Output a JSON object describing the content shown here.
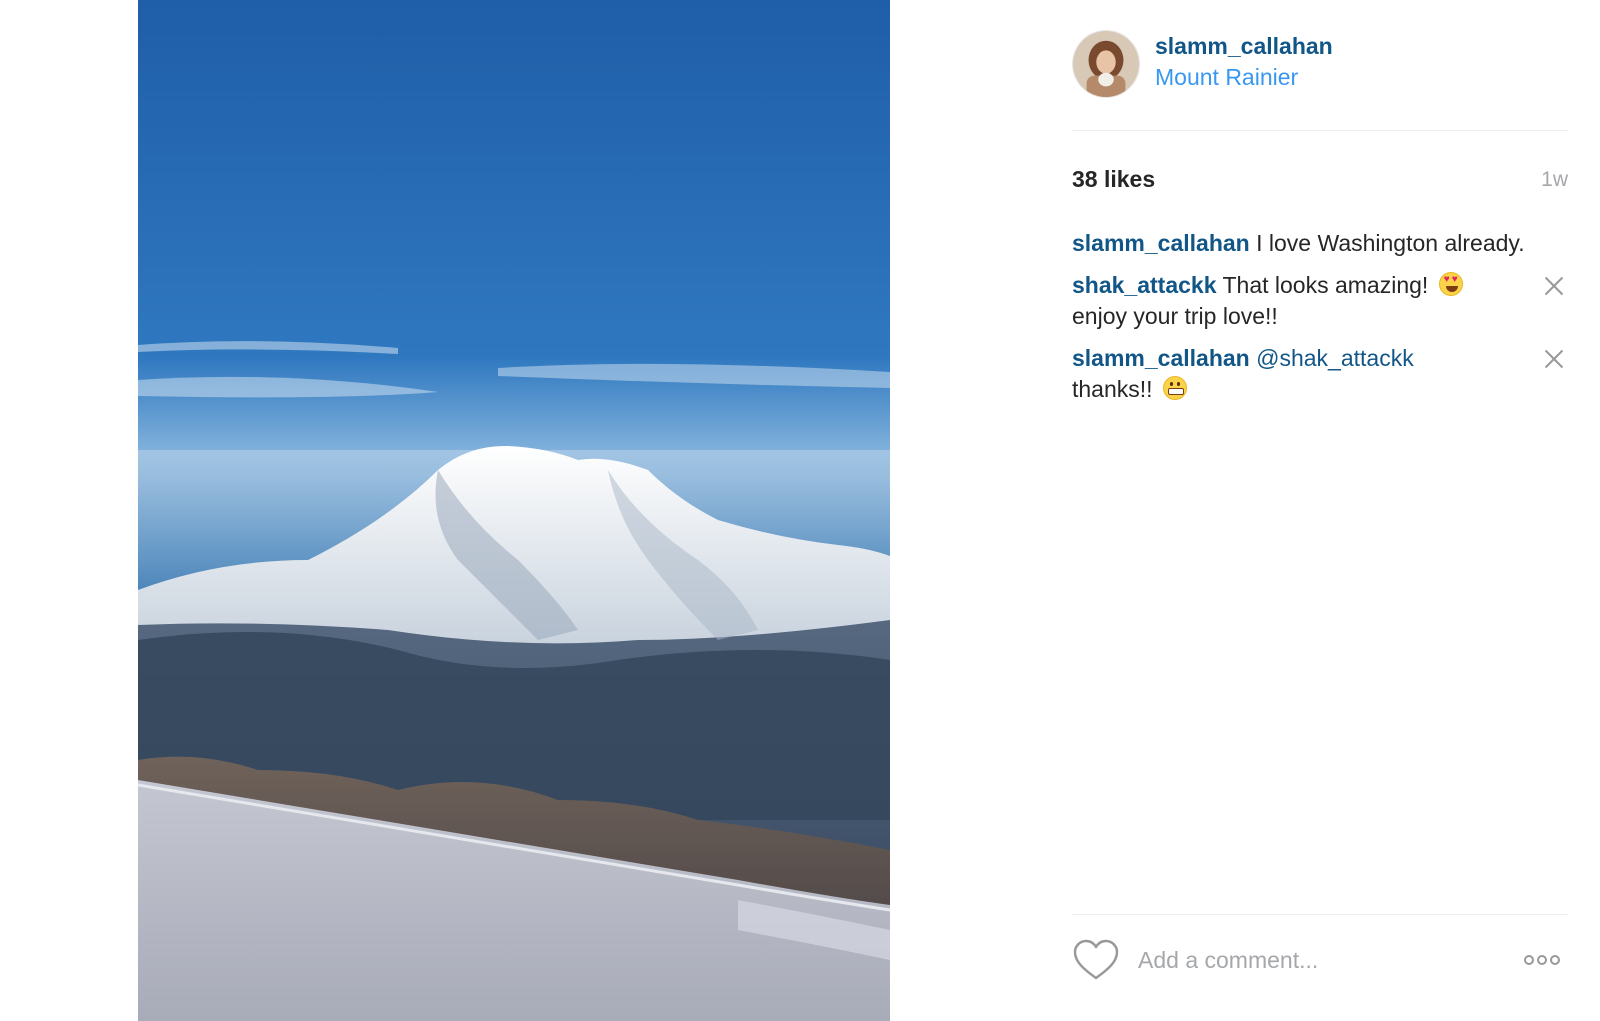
{
  "photo": {
    "subject": "Mount Rainier seen from an airplane window"
  },
  "post": {
    "owner": {
      "username": "slamm_callahan",
      "avatar_icon": "avatar-photo"
    },
    "location": "Mount Rainier",
    "likes": "38 likes",
    "time_ago": "1w"
  },
  "comments": [
    {
      "username": "slamm_callahan",
      "text": "I love Washington already.",
      "deletable": false
    },
    {
      "username": "shak_attackk",
      "text": "That looks amazing!",
      "emoji": "smiling-face-with-heart-eyes",
      "text2": "enjoy your trip love!!",
      "deletable": true
    },
    {
      "username": "slamm_callahan",
      "mention": "@shak_attackk",
      "text": "thanks!!",
      "emoji": "grimacing-face",
      "deletable": true
    }
  ],
  "footer": {
    "like_icon": "heart-outline-icon",
    "comment_placeholder": "Add a comment...",
    "more_icon": "more-options-icon"
  },
  "colors": {
    "username": "#125688",
    "location": "#3897f0",
    "muted": "#a5a7aa",
    "divider": "#efefef"
  }
}
